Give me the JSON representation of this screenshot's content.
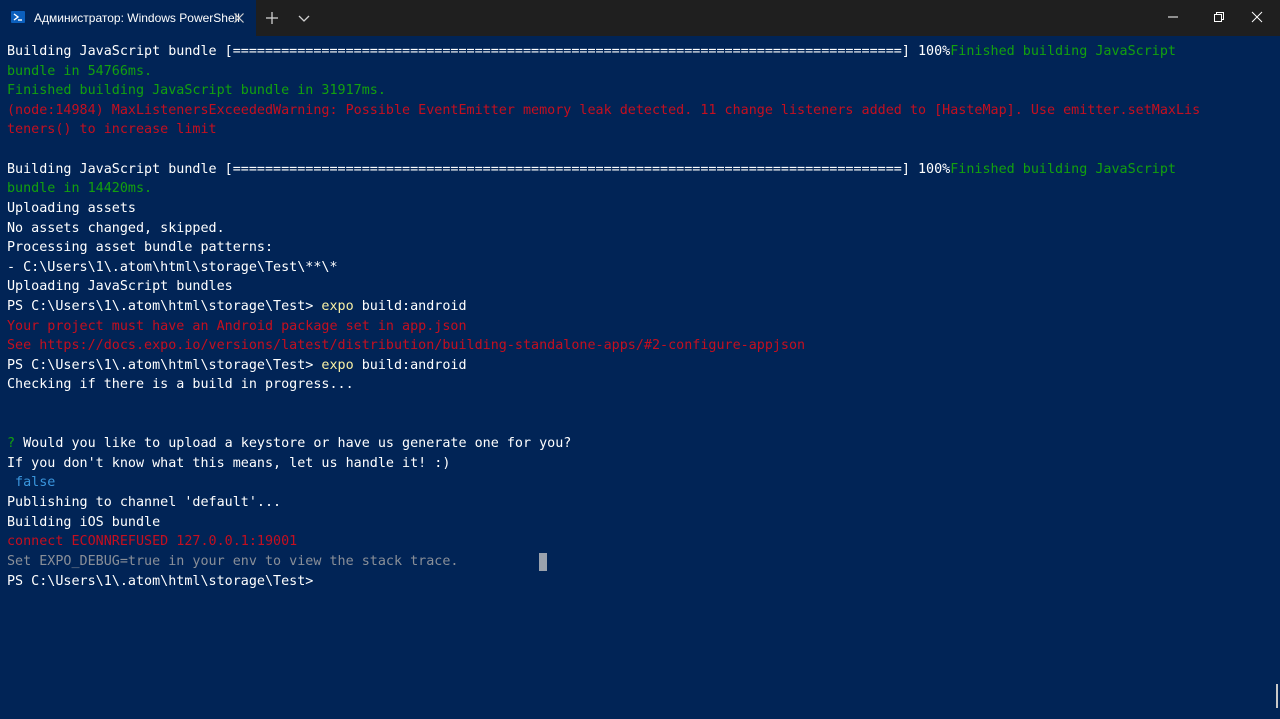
{
  "window": {
    "tab_title": "Администратор: Windows PowerShell",
    "icons": {
      "tab": "powershell-icon",
      "close_tab": "close-icon",
      "new_tab": "plus-icon",
      "dropdown": "chevron-down-icon",
      "minimize": "minimize-icon",
      "maximize": "restore-icon",
      "close": "close-icon"
    }
  },
  "colors": {
    "background": "#012456",
    "text": "#cccccc",
    "white": "#ffffff",
    "green": "#13a10e",
    "red": "#c50f1f",
    "yellow": "#f9f1a5",
    "cyan": "#3a96dd"
  },
  "terminal": {
    "l1": {
      "a": "Building JavaScript bundle [===================================================================================] 100%",
      "b": "Finished building JavaScript"
    },
    "l2": "bundle in 54766ms.",
    "l3": "Finished building JavaScript bundle in 31917ms.",
    "l4": "(node:14984) MaxListenersExceededWarning: Possible EventEmitter memory leak detected. 11 change listeners added to [HasteMap]. Use emitter.setMaxLis",
    "l5": "teners() to increase limit",
    "l7": {
      "a": "Building JavaScript bundle [===================================================================================] 100%",
      "b": "Finished building JavaScript"
    },
    "l8": "bundle in 14420ms.",
    "l9": "Uploading assets",
    "l10": "No assets changed, skipped.",
    "l11": "Processing asset bundle patterns:",
    "l12": "- C:\\Users\\1\\.atom\\html\\storage\\Test\\**\\*",
    "l13": "Uploading JavaScript bundles",
    "l14": {
      "prompt": "PS C:\\Users\\1\\.atom\\html\\storage\\Test> ",
      "cmd": "expo",
      "args": " build:android"
    },
    "l15": "Your project must have an Android package set in app.json",
    "l16": "See https://docs.expo.io/versions/latest/distribution/building-standalone-apps/#2-configure-appjson",
    "l17": {
      "prompt": "PS C:\\Users\\1\\.atom\\html\\storage\\Test> ",
      "cmd": "expo",
      "args": " build:android"
    },
    "l18": "Checking if there is a build in progress...",
    "l21": {
      "mark": "?",
      "text": " Would you like to upload a keystore or have us generate one for you?"
    },
    "l22": "If you don't know what this means, let us handle it! :)",
    "l23": " false",
    "l24": "Publishing to channel 'default'...",
    "l25": "Building iOS bundle",
    "l26": "connect ECONNREFUSED 127.0.0.1:19001",
    "l27": "Set EXPO_DEBUG=true in your env to view the stack trace.",
    "l28": "PS C:\\Users\\1\\.atom\\html\\storage\\Test>"
  }
}
